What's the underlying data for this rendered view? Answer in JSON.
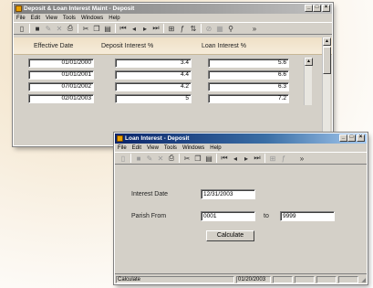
{
  "back_window": {
    "title": "Deposit & Loan Interest Maint - Deposit",
    "menu": [
      "File",
      "Edit",
      "View",
      "Tools",
      "Windows",
      "Help"
    ],
    "headers": [
      "Effective Date",
      "Deposit Interest %",
      "Loan Interest %"
    ],
    "rows": [
      {
        "date": "01/01/2000",
        "deposit": "3.4",
        "loan": "5.6"
      },
      {
        "date": "01/01/2001",
        "deposit": "4.4",
        "loan": "6.6"
      },
      {
        "date": "07/01/2002",
        "deposit": "4.2",
        "loan": "6.3"
      },
      {
        "date": "02/01/2003",
        "deposit": "5",
        "loan": "7.2"
      }
    ]
  },
  "front_window": {
    "title": "Loan Interest - Deposit",
    "menu": [
      "File",
      "Edit",
      "View",
      "Tools",
      "Windows",
      "Help"
    ],
    "interest_date_label": "Interest Date",
    "interest_date_value": "12/31/2003",
    "parish_from_label": "Parish From",
    "parish_from_value": "0001",
    "to_label": "to",
    "parish_to_value": "9999",
    "calculate_label": "Calculate",
    "status_text": "Calculate",
    "status_date": "01/20/2003"
  },
  "colors": {
    "titlebar_active": "#0a246a",
    "window_face": "#d4d0c8",
    "app_icon": "#e8a000"
  }
}
